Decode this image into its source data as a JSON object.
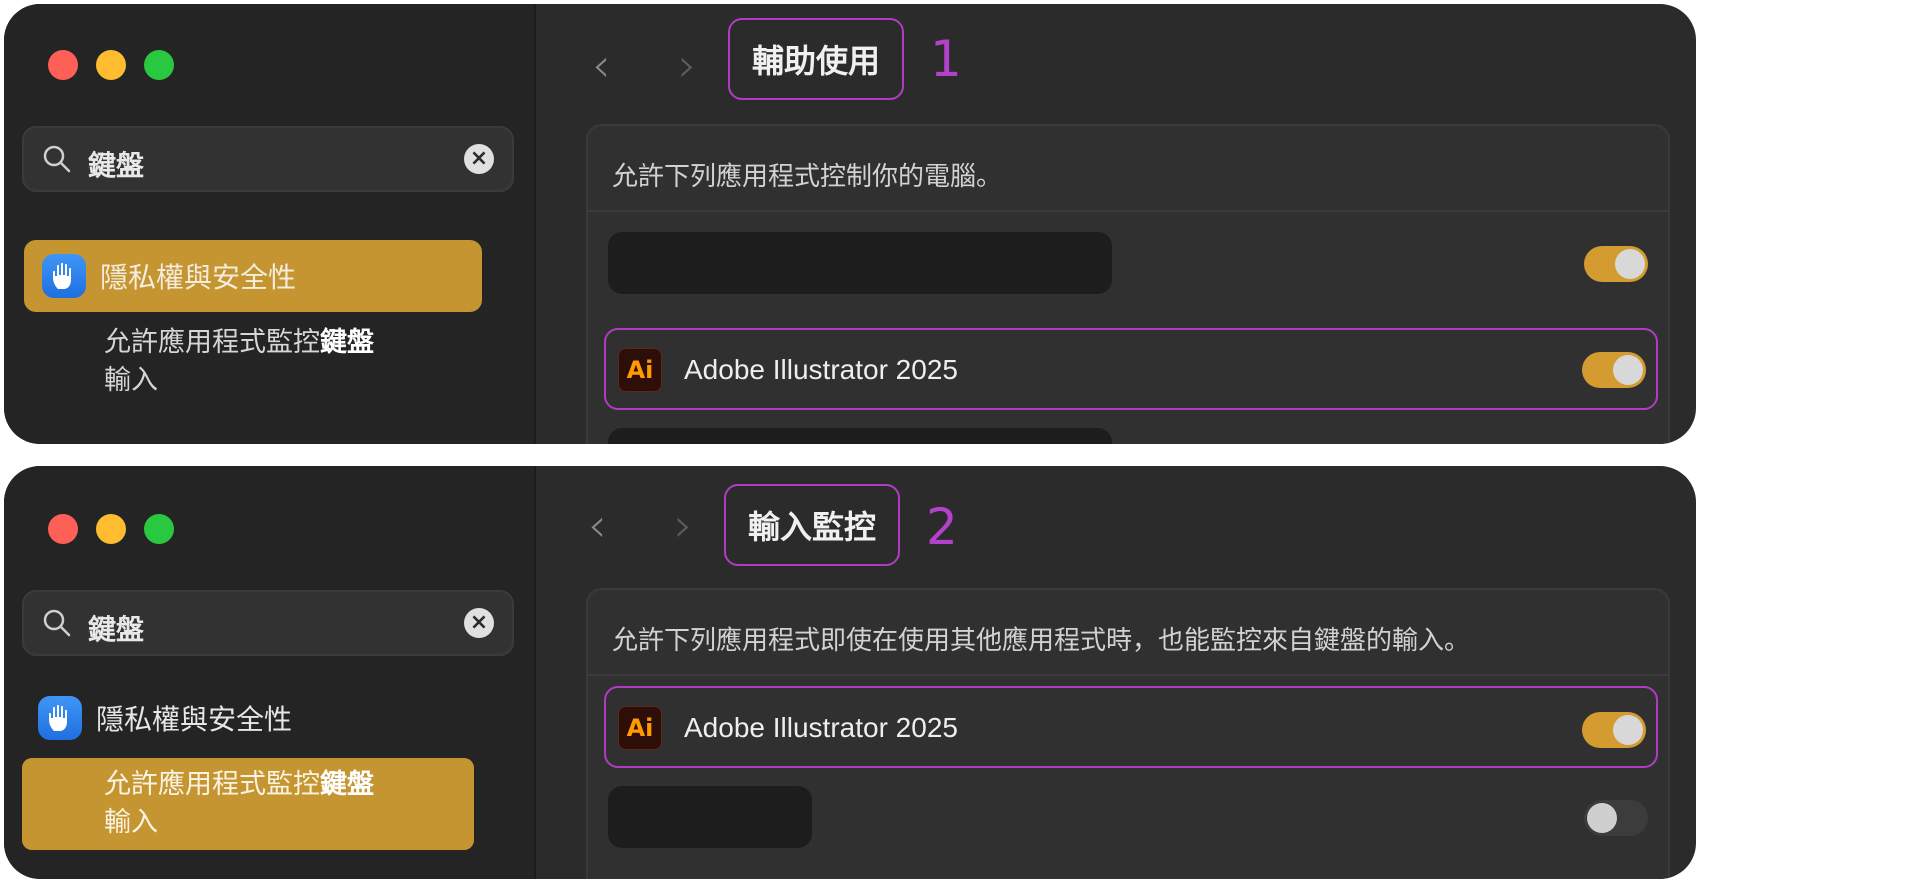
{
  "panels": [
    {
      "search": {
        "query": "鍵盤"
      },
      "sidebar": {
        "category": "隱私權與安全性",
        "subitem": [
          "允許應用程式監控",
          "鍵盤",
          "輸入"
        ]
      },
      "title": "輔助使用",
      "step": "1",
      "description": "允許下列應用程式控制你的電腦。",
      "app": {
        "icon_text": "Ai",
        "name": "Adobe Illustrator 2025"
      }
    },
    {
      "search": {
        "query": "鍵盤"
      },
      "sidebar": {
        "category": "隱私權與安全性",
        "subitem": [
          "允許應用程式監控",
          "鍵盤",
          "輸入"
        ]
      },
      "title": "輸入監控",
      "step": "2",
      "description": "允許下列應用程式即使在使用其他應用程式時，也能監控來自鍵盤的輸入。",
      "app": {
        "icon_text": "Ai",
        "name": "Adobe Illustrator 2025"
      }
    }
  ],
  "colors": {
    "highlight": "#c49530",
    "annotation": "#b03cc2",
    "toggle_on": "#d49c30"
  }
}
